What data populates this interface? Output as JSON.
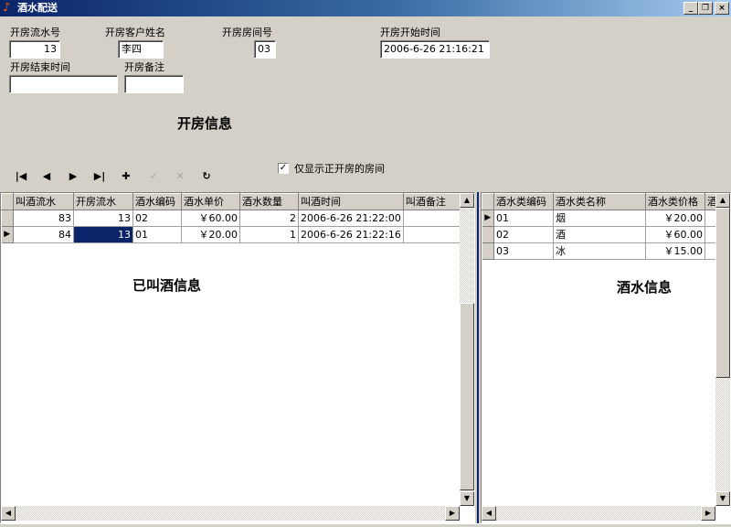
{
  "window": {
    "title": "酒水配送",
    "icon": "music-note-icon"
  },
  "window_controls": {
    "minimize": "_",
    "restore": "❐",
    "close": "×"
  },
  "form": {
    "room_serial_label": "开房流水号",
    "room_serial_value": "13",
    "guest_name_label": "开房客户姓名",
    "guest_name_value": "李四",
    "room_no_label": "开房房间号",
    "room_no_value": "03",
    "start_time_label": "开房开始时间",
    "start_time_value": "2006-6-26 21:16:21",
    "end_time_label": "开房结束时间",
    "end_time_value": "",
    "note_label": "开房备注",
    "note_value": ""
  },
  "sections": {
    "room_info": "开房信息",
    "ordered_drinks": "已叫酒信息",
    "drink_info": "酒水信息"
  },
  "navigator": {
    "first": "|◀",
    "prior": "◀",
    "next": "▶",
    "last": "▶|",
    "insert": "✚",
    "post": "✓",
    "cancel": "✕",
    "refresh": "↻"
  },
  "filter": {
    "checked": true,
    "check_mark": "✓",
    "label": "仅显示正开房的房间"
  },
  "orders_grid": {
    "columns": [
      "叫酒流水",
      "开房流水",
      "酒水编码",
      "酒水单价",
      "酒水数量",
      "叫酒时间",
      "叫酒备注"
    ],
    "rows": [
      {
        "indicator": "",
        "cells": [
          "83",
          "13",
          "02",
          "￥60.00",
          "2",
          "2006-6-26 21:22:00",
          ""
        ]
      },
      {
        "indicator": "▶",
        "cells": [
          "84",
          "13",
          "01",
          "￥20.00",
          "1",
          "2006-6-26 21:22:16",
          ""
        ]
      }
    ]
  },
  "drinks_grid": {
    "columns": [
      "酒水类编码",
      "酒水类名称",
      "酒水类价格",
      "酒"
    ],
    "rows": [
      {
        "indicator": "▶",
        "cells": [
          "01",
          "烟",
          "￥20.00",
          ""
        ]
      },
      {
        "indicator": "",
        "cells": [
          "02",
          "酒",
          "￥60.00",
          ""
        ]
      },
      {
        "indicator": "",
        "cells": [
          "03",
          "冰",
          "￥15.00",
          ""
        ]
      }
    ]
  },
  "scroll": {
    "up": "▲",
    "down": "▼",
    "left": "◀",
    "right": "▶"
  }
}
